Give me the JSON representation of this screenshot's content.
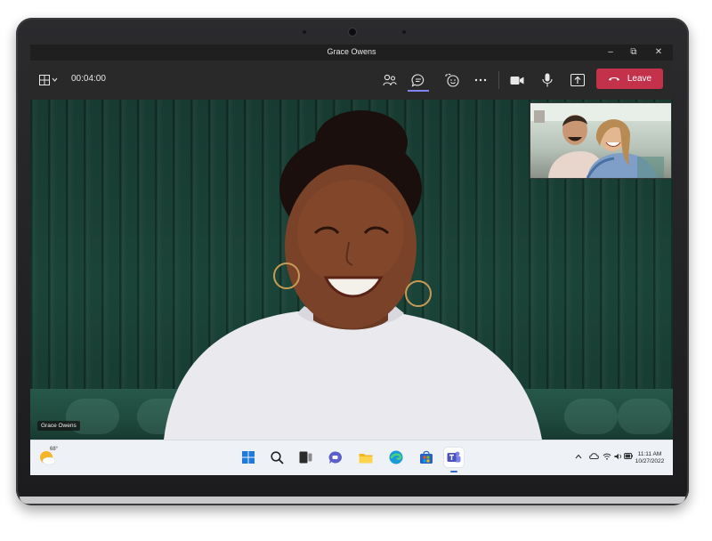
{
  "window": {
    "title": "Grace Owens",
    "controls": {
      "minimize": "–",
      "maximize": "⧉",
      "close": "✕"
    }
  },
  "toolbar": {
    "timer": "00:04:00",
    "layout_icon": "grid-layout-icon",
    "buttons": [
      "people-icon",
      "chat-icon",
      "reactions-icon",
      "more-options-icon",
      "camera-icon",
      "microphone-icon",
      "share-screen-icon"
    ],
    "leave_label": "Leave",
    "leave_color": "#c4314b"
  },
  "stage": {
    "main_participant_name": "Grace Owens"
  },
  "taskbar": {
    "weather_temp": "68°",
    "apps": [
      "start-menu-icon",
      "search-icon",
      "task-view-icon",
      "teams-chat-icon",
      "file-explorer-icon",
      "edge-browser-icon",
      "microsoft-store-icon",
      "teams-icon"
    ],
    "active_app": "teams-icon",
    "clock_time": "11:11 AM",
    "clock_date": "10/27/2022"
  },
  "colors": {
    "accent": "#7f85f5",
    "leave": "#c4314b",
    "wall": "#1b4438"
  }
}
